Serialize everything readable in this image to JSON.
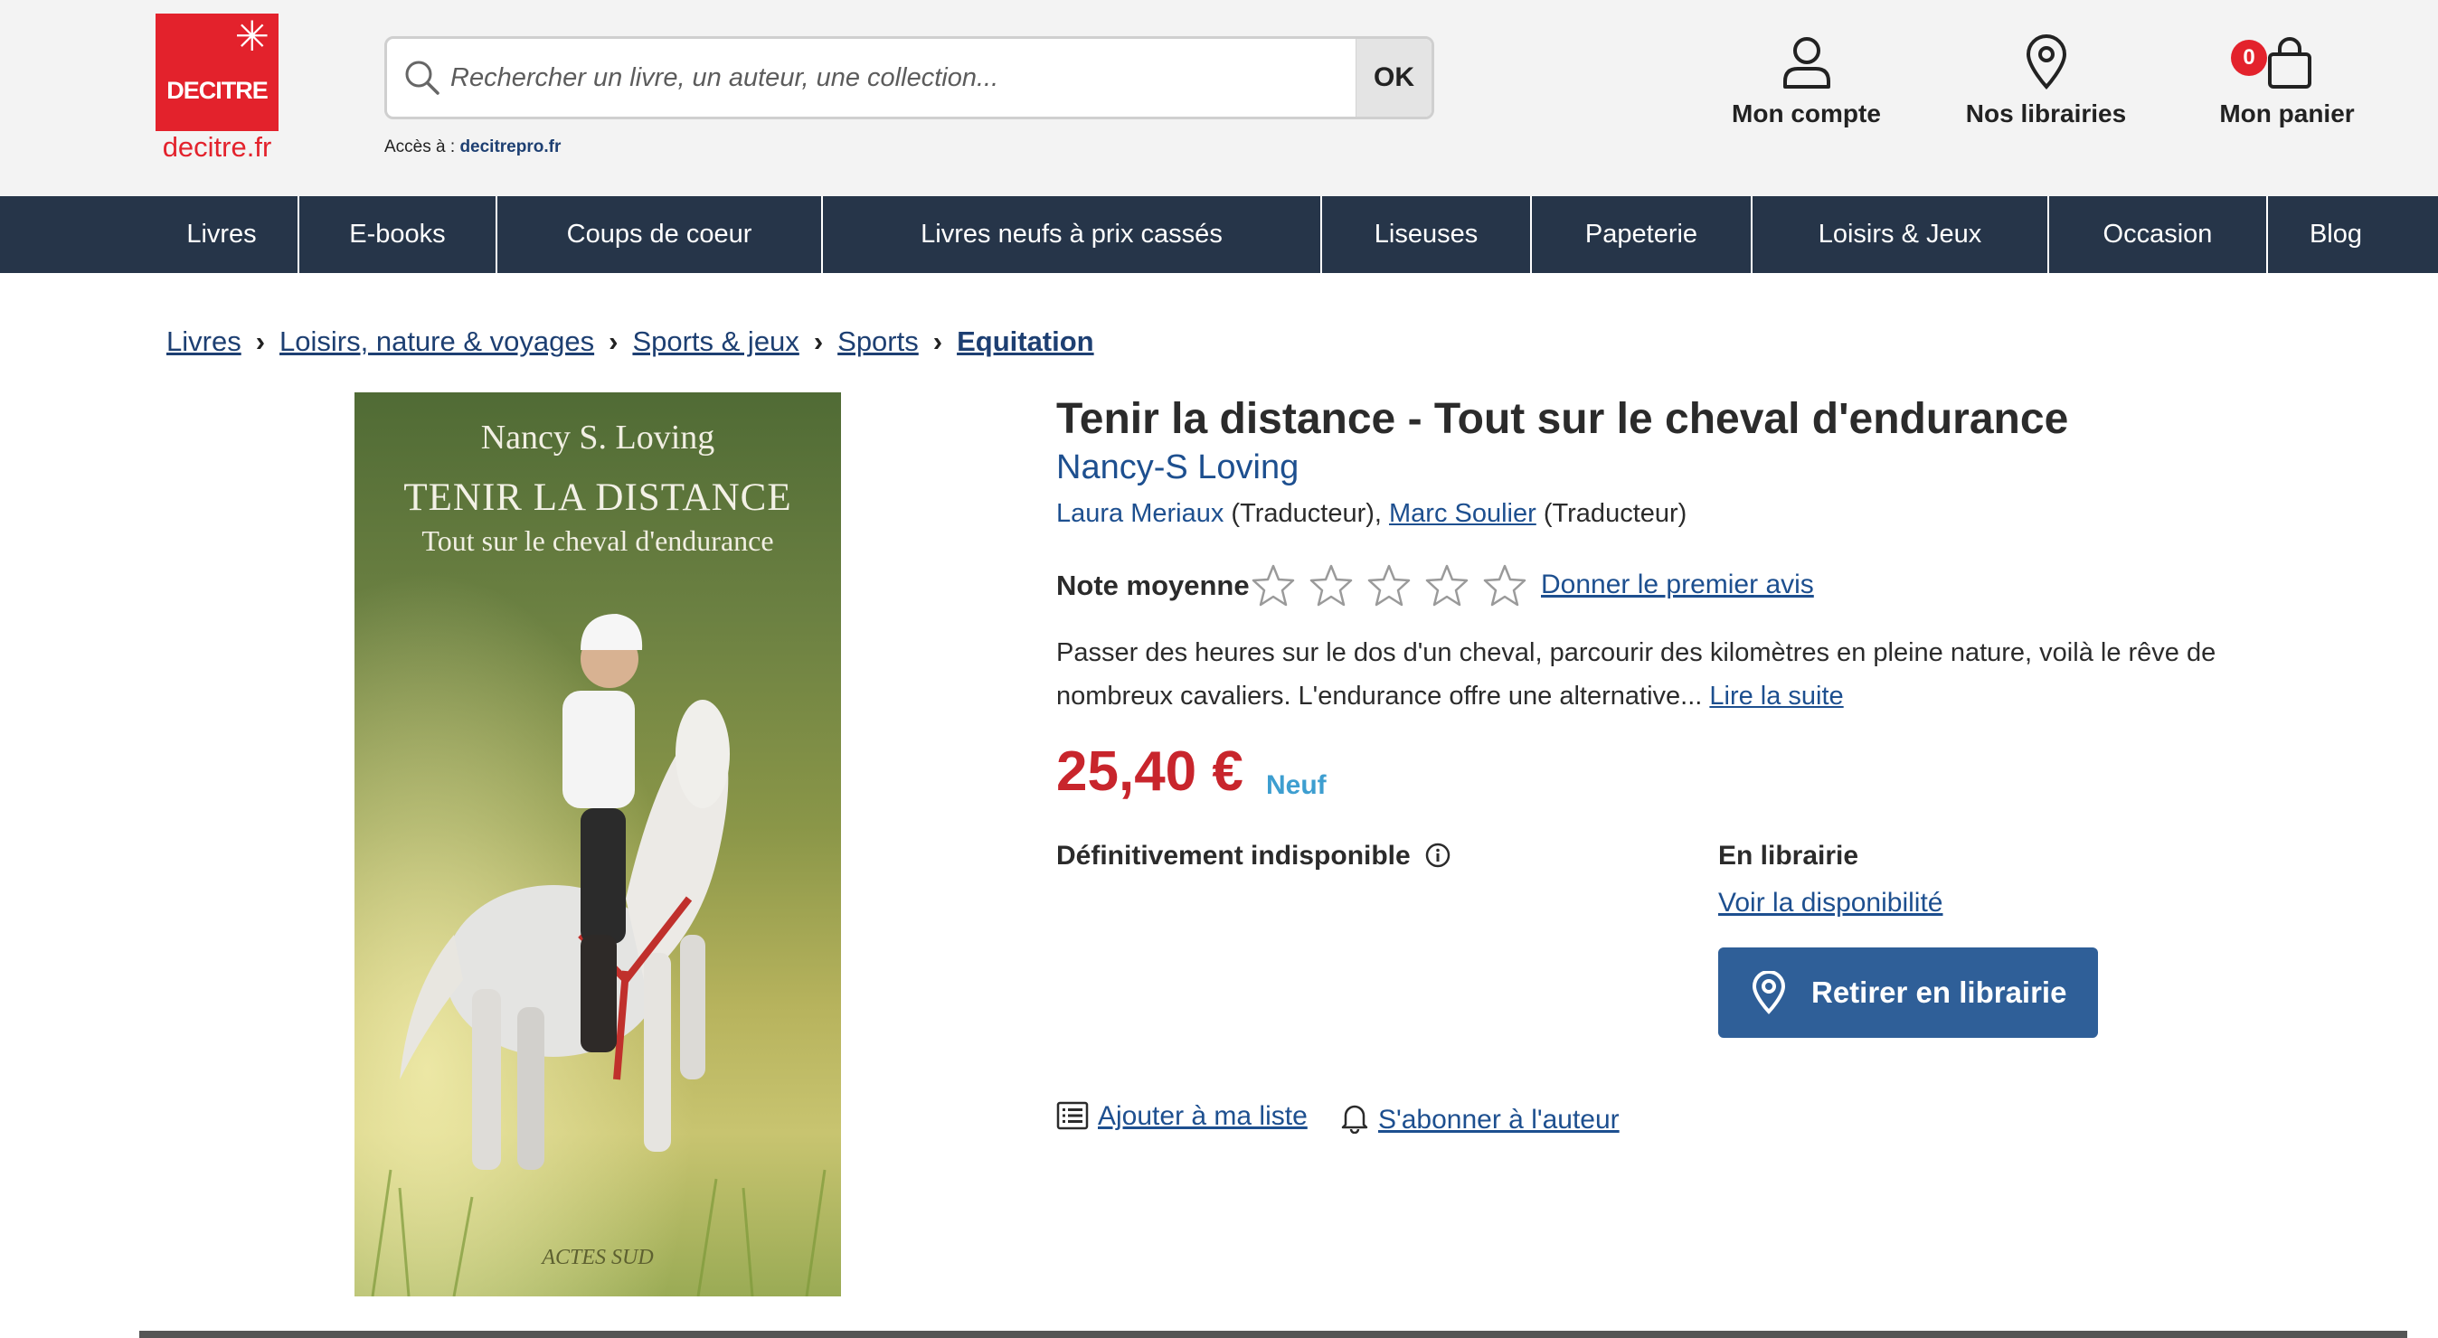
{
  "header": {
    "logo": {
      "brand": "DECITRE",
      "url": "decitre.fr"
    },
    "search": {
      "placeholder": "Rechercher un livre, un auteur, une collection...",
      "button_label": "OK"
    },
    "pro_access": {
      "label": "Accès à :",
      "link": "decitrepro.fr"
    },
    "account_label": "Mon compte",
    "stores_label": "Nos librairies",
    "cart_label": "Mon panier",
    "cart_count": "0"
  },
  "nav": {
    "items": [
      "Livres",
      "E-books",
      "Coups de coeur",
      "Livres neufs à prix cassés",
      "Liseuses",
      "Papeterie",
      "Loisirs & Jeux",
      "Occasion",
      "Blog"
    ]
  },
  "breadcrumb": {
    "items": [
      "Livres",
      "Loisirs, nature & voyages",
      "Sports & jeux",
      "Sports",
      "Equitation"
    ],
    "separator": "›"
  },
  "cover": {
    "author": "Nancy S. Loving",
    "title": "TENIR LA DISTANCE",
    "subtitle": "Tout sur le cheval d'endurance",
    "publisher": "ACTES SUD"
  },
  "product": {
    "title": "Tenir la distance - Tout sur le cheval d'endurance",
    "author": "Nancy-S Loving",
    "translator1_name": "Laura Meriaux",
    "translator1_role": " (Traducteur), ",
    "translator2_name": "Marc Soulier",
    "translator2_role": " (Traducteur)",
    "rating_label": "Note moyenne",
    "rating_value": 0,
    "rating_max": 5,
    "review_link": "Donner le premier avis",
    "description": "Passer des heures sur le dos d'un cheval, parcourir des kilomètres en pleine nature, voilà le rêve de nombreux cavaliers. L'endurance offre une alternative... ",
    "read_more": "Lire la suite",
    "price": "25,40 €",
    "condition": "Neuf",
    "availability": "Définitivement indisponible",
    "instore_title": "En librairie",
    "instore_link": "Voir la disponibilité",
    "pickup_button": "Retirer en librairie",
    "add_list": "Ajouter à ma liste",
    "subscribe_author": "S'abonner à l'auteur"
  },
  "colors": {
    "nav_bg": "#263549",
    "brand_red": "#e3222c",
    "price_red": "#c8252c",
    "link_blue": "#1d4f8f",
    "button_blue": "#2f5f98",
    "condition_blue": "#3d9ed0"
  }
}
